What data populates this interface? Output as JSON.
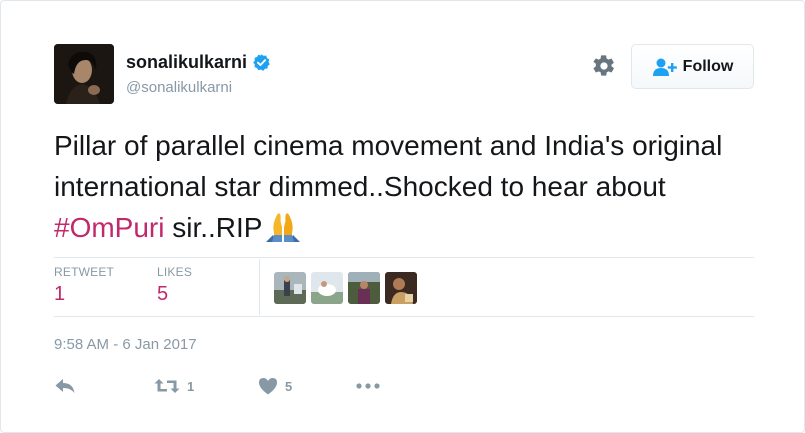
{
  "user": {
    "display_name": "sonalikulkarni",
    "handle": "@sonalikulkarni",
    "verified": true
  },
  "follow_button": {
    "label": "Follow"
  },
  "tweet": {
    "text_before": "Pillar of parallel cinema movement and India's original international star dimmed..Shocked to hear about ",
    "hashtag": "#OmPuri",
    "text_after": " sir..RIP"
  },
  "stats": {
    "retweets_label": "RETWEET",
    "retweets_value": "1",
    "likes_label": "LIKES",
    "likes_value": "5"
  },
  "likers": [
    "liker-1",
    "liker-2",
    "liker-3",
    "liker-4"
  ],
  "timestamp": "9:58 AM - 6 Jan 2017",
  "actions": {
    "reply_icon": "reply-icon",
    "retweet_count": "1",
    "like_count": "5",
    "more_icon": "more-icon"
  },
  "colors": {
    "accent": "#c2296d",
    "muted": "#8899a6",
    "verified_blue": "#1da1f2",
    "follow_icon_blue": "#1da1f2"
  }
}
